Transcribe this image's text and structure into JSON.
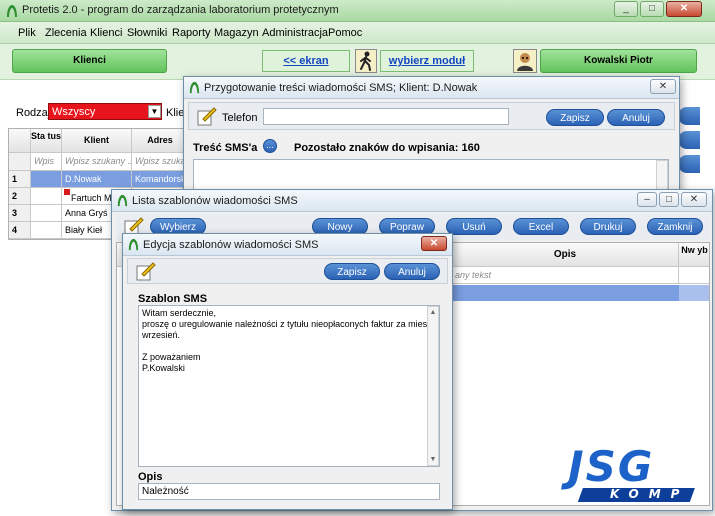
{
  "main": {
    "title": "Protetis 2.0 - program do zarządzania laboratorium protetycznym",
    "menu": [
      "Plik",
      "Zlecenia",
      "Klienci",
      "Słowniki",
      "Raporty",
      "Magazyn",
      "Administracja",
      "Pomoc"
    ],
    "toolbar": {
      "section": "Klienci",
      "home_link": "<< ekran główny",
      "module_link": "wybierz moduł >>",
      "user": "Kowalski Piotr"
    },
    "filter": {
      "rodzaj_label": "Rodzaj",
      "rodzaj_value": "Wszyscy",
      "klient_label": "Klie"
    },
    "grid": {
      "headers": [
        "Sta tus",
        "Klient",
        "Adres"
      ],
      "filter_placeholder_status": "Wpis",
      "filter_placeholder_klient": "Wpisz szukany ...",
      "filter_placeholder_adres": "Wpisz szukan",
      "rows": [
        {
          "num": "1",
          "klient": "D.Nowak",
          "adres": "Komandorska"
        },
        {
          "num": "2",
          "klient": "Fartuch M",
          "adres": ""
        },
        {
          "num": "3",
          "klient": "Anna Gryś",
          "adres": ""
        },
        {
          "num": "4",
          "klient": "Biały Kieł",
          "adres": ""
        }
      ]
    }
  },
  "sms_window": {
    "title": "Przygotowanie treści wiadomości SMS; Klient: D.Nowak",
    "phone_label": "Telefon",
    "phone_value": "",
    "save": "Zapisz",
    "cancel": "Anuluj",
    "content_label": "Treść SMS'a",
    "more_button": "...",
    "remaining": "Pozostało znaków do wpisania: 160"
  },
  "templates_window": {
    "title": "Lista szablonów wiadomości SMS",
    "buttons": [
      "Wybierz",
      "Nowy",
      "Popraw",
      "Usuń",
      "Excel",
      "Drukuj",
      "Zamknij"
    ],
    "col_opis": "Opis",
    "col_nwyb": "Nw yb",
    "filter_placeholder": "any tekst"
  },
  "edit_window": {
    "title": "Edycja szablonów wiadomości SMS",
    "save": "Zapisz",
    "cancel": "Anuluj",
    "template_label": "Szablon SMS",
    "template_lines": [
      "Witam serdecznie,",
      "proszę o uregulowanie należności z tytułu nieopłaconych faktur za miesiąc",
      "wrzesień.",
      "",
      "Z poważaniem",
      "P.Kowalski"
    ],
    "opis_label": "Opis",
    "opis_value": "Należność"
  },
  "logo": {
    "top": "JSG",
    "bottom": "KOMP"
  },
  "colors": {
    "accent_blue": "#2b62b4",
    "green_bar": "#63c35c",
    "select_red": "#e8141b",
    "selected_row": "#7a9ee0"
  }
}
